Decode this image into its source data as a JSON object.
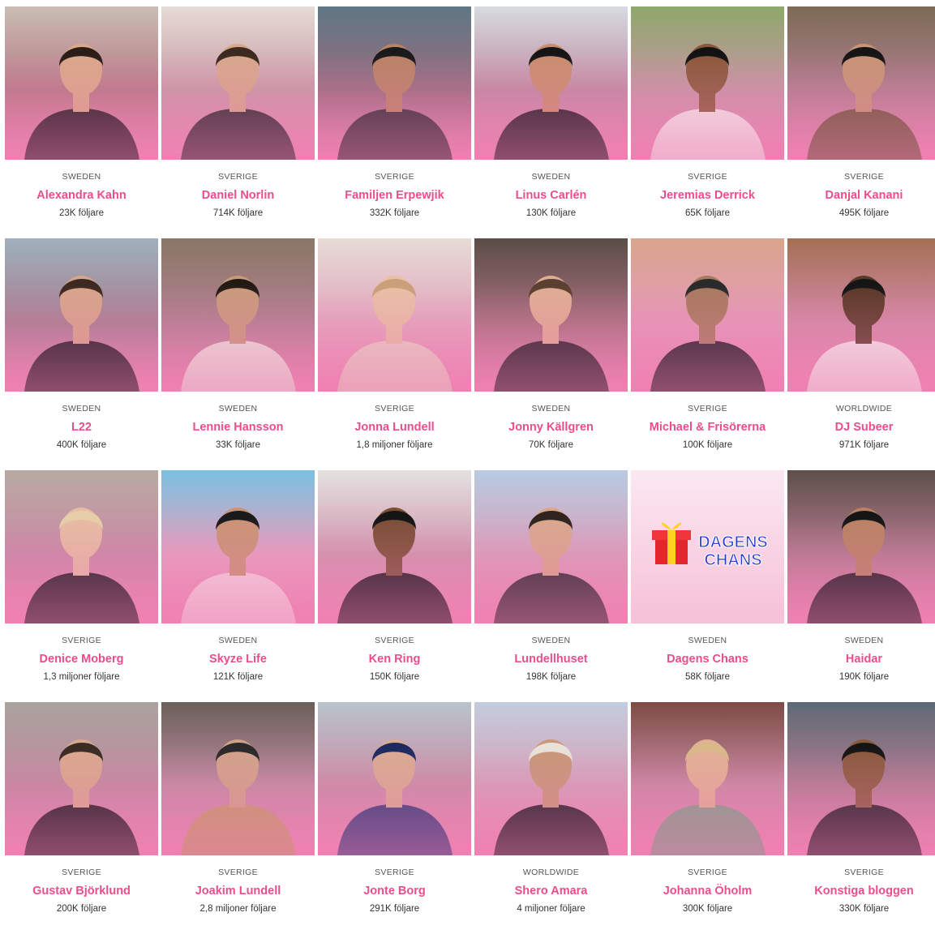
{
  "colors": {
    "accent": "#ec4d8c",
    "overlay": "#f08ab7"
  },
  "influencers": [
    {
      "country": "SWEDEN",
      "name": "Alexandra Kahn",
      "followers": "23K följare",
      "bg": [
        "#c9bdb3",
        "#b77a86"
      ],
      "skin": "#d9a989",
      "cloth": "#1d1a1f",
      "hair": "#2a1d17"
    },
    {
      "country": "SVERIGE",
      "name": "Daniel Norlin",
      "followers": "714K följare",
      "bg": [
        "#e6dbd5",
        "#c79aa5"
      ],
      "skin": "#d7a88c",
      "cloth": "#2a2a2e",
      "hair": "#3b2a20"
    },
    {
      "country": "SVERIGE",
      "name": "Familjen Erpewjik",
      "followers": "332K följare",
      "bg": [
        "#5f7784",
        "#9a6d7f"
      ],
      "skin": "#b88366",
      "cloth": "#2c2c30",
      "hair": "#1a1a1a"
    },
    {
      "country": "SWEDEN",
      "name": "Linus Carlén",
      "followers": "130K följare",
      "bg": [
        "#d6dbe0",
        "#c08ba2"
      ],
      "skin": "#c98e6e",
      "cloth": "#1c1c20",
      "hair": "#151515"
    },
    {
      "country": "SVERIGE",
      "name": "Jeremias Derrick",
      "followers": "65K följare",
      "bg": [
        "#8ea86a",
        "#c895a6"
      ],
      "skin": "#8a5a3c",
      "cloth": "#f2ecec",
      "hair": "#121212"
    },
    {
      "country": "SVERIGE",
      "name": "Danjal Kanani",
      "followers": "495K följare",
      "bg": [
        "#7b6a55",
        "#b07f8e"
      ],
      "skin": "#c59575",
      "cloth": "#6a5638",
      "hair": "#151515"
    },
    {
      "country": "SWEDEN",
      "name": "L22",
      "followers": "400K följare",
      "bg": [
        "#9fb0bc",
        "#a77f91"
      ],
      "skin": "#d6a58a",
      "cloth": "#1a1a1e",
      "hair": "#3c2a20"
    },
    {
      "country": "SWEDEN",
      "name": "Lennie Hansson",
      "followers": "33K följare",
      "bg": [
        "#8a7766",
        "#b08090"
      ],
      "skin": "#c89a7c",
      "cloth": "#e9e3dc",
      "hair": "#241a14"
    },
    {
      "country": "SVERIGE",
      "name": "Jonna Lundell",
      "followers": "1,8 miljoner följare",
      "bg": [
        "#e6dcd6",
        "#e3a7bd"
      ],
      "skin": "#e8c0a6",
      "cloth": "#e7d2c6",
      "hair": "#caa07a"
    },
    {
      "country": "SWEDEN",
      "name": "Jonny Källgren",
      "followers": "70K följare",
      "bg": [
        "#5a4d46",
        "#a8707f"
      ],
      "skin": "#e0ad93",
      "cloth": "#1f1f24",
      "hair": "#5a4030"
    },
    {
      "country": "SVERIGE",
      "name": "Michael & Frisörerna",
      "followers": "100K följare",
      "bg": [
        "#d9a58c",
        "#e49ab8"
      ],
      "skin": "#a87a60",
      "cloth": "#1e1e22",
      "hair": "#2a2a2a"
    },
    {
      "country": "WORLDWIDE",
      "name": "DJ Subeer",
      "followers": "971K följare",
      "bg": [
        "#a46f54",
        "#d38aa6"
      ],
      "skin": "#5a3a28",
      "cloth": "#f2ecec",
      "hair": "#151515"
    },
    {
      "country": "SVERIGE",
      "name": "Denice Moberg",
      "followers": "1,3 miljoner följare",
      "bg": [
        "#b8aaa1",
        "#c98aa5"
      ],
      "skin": "#e6bca4",
      "cloth": "#1c1c20",
      "hair": "#e6cfa8"
    },
    {
      "country": "SWEDEN",
      "name": "Skyze Life",
      "followers": "121K följare",
      "bg": [
        "#7ac0e0",
        "#e7a0bf"
      ],
      "skin": "#c99476",
      "cloth": "#f3d6e0",
      "hair": "#1a1a1a"
    },
    {
      "country": "SVERIGE",
      "name": "Ken Ring",
      "followers": "150K följare",
      "bg": [
        "#e4e1e0",
        "#cf97ae"
      ],
      "skin": "#7a4f36",
      "cloth": "#1a1a1e",
      "hair": "#141414"
    },
    {
      "country": "SWEDEN",
      "name": "Lundellhuset",
      "followers": "198K följare",
      "bg": [
        "#b7cbe2",
        "#d9a0ba"
      ],
      "skin": "#d9a88c",
      "cloth": "#2a2a2e",
      "hair": "#2e241d"
    },
    {
      "country": "SWEDEN",
      "name": "Dagens Chans",
      "followers": "58K följare",
      "logo": true,
      "logo_text_1": "DAGENS",
      "logo_text_2": "CHANS"
    },
    {
      "country": "SWEDEN",
      "name": "Haidar",
      "followers": "190K följare",
      "bg": [
        "#5e4f4a",
        "#b27a8e"
      ],
      "skin": "#b88263",
      "cloth": "#1a1a1e",
      "hair": "#151515"
    },
    {
      "country": "SVERIGE",
      "name": "Gustav Björklund",
      "followers": "200K följare",
      "bg": [
        "#a9a39d",
        "#c28aa0"
      ],
      "skin": "#d9a88e",
      "cloth": "#1a1a1e",
      "hair": "#3a2c22"
    },
    {
      "country": "SVERIGE",
      "name": "Joakim Lundell",
      "followers": "2,8 miljoner följare",
      "bg": [
        "#6a5f59",
        "#c28ca2"
      ],
      "skin": "#d1a28a",
      "cloth": "#c49a6c",
      "hair": "#2a2a2a"
    },
    {
      "country": "SVERIGE",
      "name": "Jonte Borg",
      "followers": "291K följare",
      "bg": [
        "#b9c3cb",
        "#c98ea6"
      ],
      "skin": "#d9ab92",
      "cloth": "#2d3a78",
      "hair": "#1d2a60"
    },
    {
      "country": "WORLDWIDE",
      "name": "Shero Amara",
      "followers": "4 miljoner följare",
      "bg": [
        "#c3cddd",
        "#d6a0b8"
      ],
      "skin": "#c8987a",
      "cloth": "#1c1c22",
      "hair": "#e9e2d8"
    },
    {
      "country": "SVERIGE",
      "name": "Johanna Öholm",
      "followers": "300K följare",
      "bg": [
        "#7d4b43",
        "#c98aa4"
      ],
      "skin": "#e2b095",
      "cloth": "#7fa08a",
      "hair": "#d9b88a"
    },
    {
      "country": "SVERIGE",
      "name": "Konstiga bloggen",
      "followers": "330K följare",
      "bg": [
        "#5d6a74",
        "#b27c92"
      ],
      "skin": "#8a5a3e",
      "cloth": "#1c1c20",
      "hair": "#151515"
    }
  ]
}
